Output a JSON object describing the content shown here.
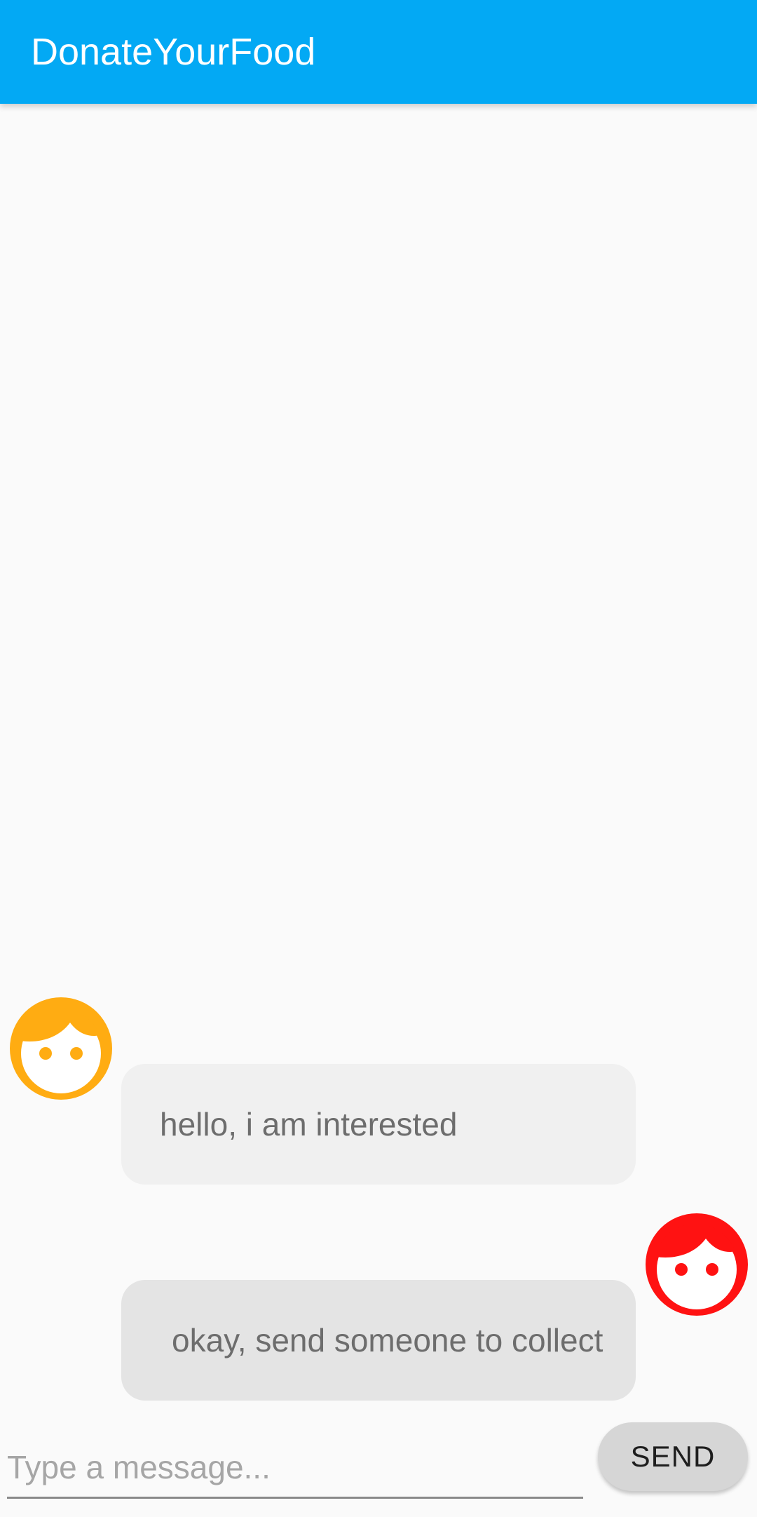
{
  "app_bar": {
    "title": "DonateYourFood",
    "color": "#03a9f4"
  },
  "messages": [
    {
      "text": "hello, i am interested",
      "avatar_icon": "face-icon",
      "avatar_color": "#ffac12"
    },
    {
      "text": "okay, send someone to collect",
      "avatar_icon": "face-icon",
      "avatar_color": "#ff1212"
    }
  ],
  "composer": {
    "input_value": "",
    "input_placeholder": "Type a message...",
    "send_label": "SEND"
  }
}
